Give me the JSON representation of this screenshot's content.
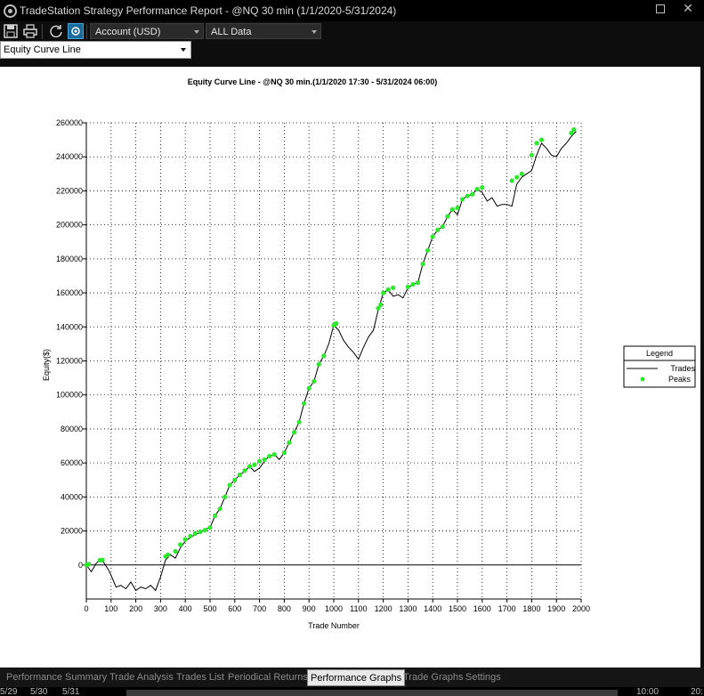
{
  "window": {
    "title": "TradeStation Strategy Performance Report - @NQ 30 min (1/1/2020-5/31/2024)",
    "maximize_symbol": "□",
    "close_symbol": "✕"
  },
  "toolbar": {
    "icons": [
      "save-icon",
      "print-icon",
      "refresh-icon",
      "settings-icon"
    ],
    "account_value": "Account (USD)",
    "range_value": "ALL Data"
  },
  "graph_select": {
    "value": "Equity Curve Line"
  },
  "chart_data": {
    "type": "line",
    "title": "Equity Curve Line - @NQ 30 min.(1/1/2020 17:30 - 5/31/2024 06:00)",
    "xlabel": "Trade Number",
    "ylabel": "Equity($)",
    "xlim": [
      0,
      2000
    ],
    "ylim": [
      -20000,
      260000
    ],
    "xticks": [
      0,
      100,
      200,
      300,
      400,
      500,
      600,
      700,
      800,
      900,
      1000,
      1100,
      1200,
      1300,
      1400,
      1500,
      1600,
      1700,
      1800,
      1900,
      2000
    ],
    "yticks": [
      0,
      20000,
      40000,
      60000,
      80000,
      100000,
      120000,
      140000,
      160000,
      180000,
      200000,
      220000,
      240000,
      260000
    ],
    "grid": true,
    "legend": {
      "title": "Legend",
      "placement": "right",
      "entries": [
        "Trades",
        "Peaks"
      ]
    },
    "colors": {
      "trades": "#000000",
      "peaks": "#2ee82e"
    },
    "series": [
      {
        "name": "Trades",
        "x": [
          0,
          20,
          40,
          55,
          70,
          90,
          100,
          120,
          140,
          160,
          180,
          200,
          220,
          240,
          260,
          280,
          300,
          320,
          340,
          360,
          380,
          400,
          420,
          440,
          460,
          480,
          500,
          520,
          540,
          560,
          580,
          600,
          620,
          640,
          660,
          680,
          700,
          720,
          740,
          760,
          780,
          800,
          820,
          840,
          860,
          880,
          900,
          920,
          940,
          960,
          980,
          1000,
          1020,
          1040,
          1060,
          1080,
          1100,
          1120,
          1140,
          1160,
          1180,
          1200,
          1220,
          1240,
          1260,
          1280,
          1300,
          1320,
          1340,
          1360,
          1380,
          1400,
          1420,
          1440,
          1460,
          1480,
          1500,
          1520,
          1540,
          1560,
          1580,
          1600,
          1620,
          1640,
          1660,
          1680,
          1700,
          1720,
          1740,
          1760,
          1780,
          1800,
          1820,
          1840,
          1860,
          1880,
          1900,
          1920,
          1940,
          1960,
          1980
        ],
        "y": [
          0,
          -4000,
          1000,
          3000,
          1500,
          -3000,
          -6000,
          -13000,
          -12000,
          -14000,
          -10000,
          -15000,
          -13000,
          -14000,
          -12000,
          -15000,
          -7000,
          3000,
          6000,
          4000,
          10000,
          14000,
          16000,
          18000,
          19000,
          21000,
          22000,
          29000,
          33000,
          40000,
          47000,
          50000,
          53000,
          55000,
          58000,
          55000,
          57000,
          61000,
          64000,
          65000,
          62000,
          66000,
          72000,
          78000,
          84000,
          95000,
          104000,
          108000,
          118000,
          123000,
          130000,
          141000,
          138000,
          132000,
          128000,
          125000,
          121000,
          128000,
          134000,
          138000,
          150000,
          160000,
          162000,
          158000,
          159000,
          157000,
          163000,
          165000,
          166000,
          177000,
          185000,
          193000,
          197000,
          199000,
          205000,
          209000,
          206000,
          215000,
          217000,
          218000,
          221000,
          219000,
          214000,
          216000,
          211000,
          212000,
          212000,
          211000,
          224000,
          228000,
          230000,
          232000,
          241000,
          248000,
          245000,
          241000,
          240000,
          245000,
          248000,
          252000,
          255000
        ]
      },
      {
        "name": "Peaks",
        "x": [
          0,
          10,
          55,
          65,
          320,
          330,
          360,
          380,
          400,
          420,
          440,
          460,
          480,
          500,
          520,
          540,
          560,
          580,
          600,
          620,
          640,
          660,
          680,
          700,
          720,
          740,
          760,
          800,
          820,
          840,
          860,
          880,
          900,
          920,
          940,
          960,
          1000,
          1010,
          1180,
          1190,
          1200,
          1220,
          1240,
          1300,
          1320,
          1340,
          1360,
          1380,
          1400,
          1420,
          1440,
          1460,
          1480,
          1500,
          1520,
          1540,
          1560,
          1580,
          1600,
          1720,
          1740,
          1760,
          1800,
          1820,
          1840,
          1960,
          1970
        ],
        "y": [
          0,
          500,
          2800,
          3000,
          5000,
          6000,
          8000,
          12000,
          15000,
          17000,
          18500,
          19500,
          20500,
          22000,
          29000,
          33000,
          40000,
          47000,
          50000,
          53000,
          55500,
          58000,
          59000,
          61000,
          62000,
          64000,
          65000,
          66000,
          72000,
          78000,
          84000,
          95000,
          104000,
          108000,
          118000,
          123000,
          141000,
          142000,
          151000,
          153000,
          160000,
          162000,
          163000,
          163500,
          165000,
          166000,
          177000,
          185000,
          193000,
          197000,
          199000,
          205000,
          209000,
          210000,
          215000,
          217000,
          218000,
          221000,
          222000,
          226000,
          228000,
          230000,
          241000,
          248000,
          250000,
          254000,
          256000
        ]
      }
    ]
  },
  "tabs": [
    {
      "label": "Performance Summary",
      "active": false
    },
    {
      "label": "Trade Analysis",
      "active": false
    },
    {
      "label": "Trades List",
      "active": false
    },
    {
      "label": "Periodical Returns",
      "active": false
    },
    {
      "label": "Performance Graphs",
      "active": true
    },
    {
      "label": "Trade Graphs",
      "active": false
    },
    {
      "label": "Settings",
      "active": false
    }
  ],
  "statusbar": {
    "left": [
      "5/29",
      "5/30",
      "5/31"
    ],
    "time": "10:00",
    "right": "20:"
  }
}
